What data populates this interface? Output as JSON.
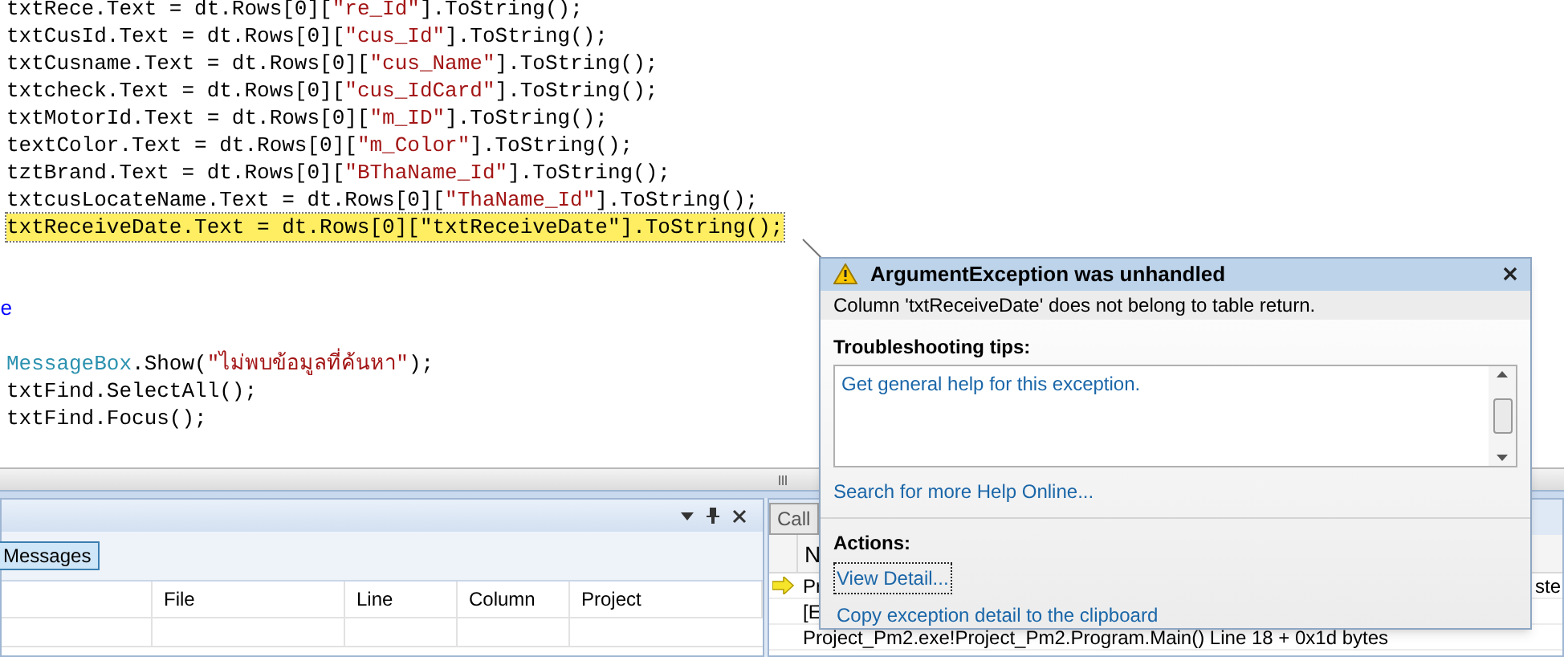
{
  "editor": {
    "lines": [
      {
        "kind": "code",
        "highlighted": false,
        "tokens": [
          {
            "kind": "plain",
            "text": "txtRece.Text = dt.Rows[0]["
          },
          {
            "kind": "string",
            "text": "\"re_Id\""
          },
          {
            "kind": "plain",
            "text": "].ToString();"
          }
        ]
      },
      {
        "kind": "code",
        "highlighted": false,
        "tokens": [
          {
            "kind": "plain",
            "text": "txtCusId.Text = dt.Rows[0]["
          },
          {
            "kind": "string",
            "text": "\"cus_Id\""
          },
          {
            "kind": "plain",
            "text": "].ToString();"
          }
        ]
      },
      {
        "kind": "code",
        "highlighted": false,
        "tokens": [
          {
            "kind": "plain",
            "text": "txtCusname.Text = dt.Rows[0]["
          },
          {
            "kind": "string",
            "text": "\"cus_Name\""
          },
          {
            "kind": "plain",
            "text": "].ToString();"
          }
        ]
      },
      {
        "kind": "code",
        "highlighted": false,
        "tokens": [
          {
            "kind": "plain",
            "text": "txtcheck.Text = dt.Rows[0]["
          },
          {
            "kind": "string",
            "text": "\"cus_IdCard\""
          },
          {
            "kind": "plain",
            "text": "].ToString();"
          }
        ]
      },
      {
        "kind": "code",
        "highlighted": false,
        "tokens": [
          {
            "kind": "plain",
            "text": "txtMotorId.Text = dt.Rows[0]["
          },
          {
            "kind": "string",
            "text": "\"m_ID\""
          },
          {
            "kind": "plain",
            "text": "].ToString();"
          }
        ]
      },
      {
        "kind": "code",
        "highlighted": false,
        "tokens": [
          {
            "kind": "plain",
            "text": "textColor.Text = dt.Rows[0]["
          },
          {
            "kind": "string",
            "text": "\"m_Color\""
          },
          {
            "kind": "plain",
            "text": "].ToString();"
          }
        ]
      },
      {
        "kind": "code",
        "highlighted": false,
        "tokens": [
          {
            "kind": "plain",
            "text": "tztBrand.Text = dt.Rows[0]["
          },
          {
            "kind": "string",
            "text": "\"BThaName_Id\""
          },
          {
            "kind": "plain",
            "text": "].ToString();"
          }
        ]
      },
      {
        "kind": "code",
        "highlighted": false,
        "tokens": [
          {
            "kind": "plain",
            "text": "txtcusLocateName.Text = dt.Rows[0]["
          },
          {
            "kind": "string",
            "text": "\"ThaName_Id\""
          },
          {
            "kind": "plain",
            "text": "].ToString();"
          }
        ]
      },
      {
        "kind": "code",
        "highlighted": true,
        "tokens": [
          {
            "kind": "plain",
            "text": "txtReceiveDate.Text = dt.Rows[0][\"txtReceiveDate\"].ToString();"
          }
        ]
      },
      {
        "kind": "blank"
      },
      {
        "kind": "blank"
      },
      {
        "kind": "outdent",
        "highlighted": false,
        "tokens": [
          {
            "kind": "keyword",
            "text": "e"
          }
        ]
      },
      {
        "kind": "blank"
      },
      {
        "kind": "code",
        "highlighted": false,
        "tokens": [
          {
            "kind": "type",
            "text": "MessageBox"
          },
          {
            "kind": "plain",
            "text": ".Show("
          },
          {
            "kind": "string",
            "text": "\"ไม่พบข้อมูลที่ค้นหา\""
          },
          {
            "kind": "plain",
            "text": ");"
          }
        ]
      },
      {
        "kind": "code",
        "highlighted": false,
        "tokens": [
          {
            "kind": "plain",
            "text": "txtFind.SelectAll();"
          }
        ]
      },
      {
        "kind": "code",
        "highlighted": false,
        "tokens": [
          {
            "kind": "plain",
            "text": "txtFind.Focus();"
          }
        ]
      }
    ]
  },
  "error_list": {
    "toolbar": [
      {
        "label": "Messages",
        "selected": true
      }
    ],
    "columns": [
      "File",
      "Line",
      "Column",
      "Project"
    ]
  },
  "call_stack": {
    "title": "Call",
    "column_header": "N",
    "rows": [
      {
        "current": true,
        "column_1": "Pr",
        "column_2": "ste"
      },
      {
        "current": false,
        "column_1": "[E"
      },
      {
        "current": false,
        "column_1": "Project_Pm2.exe!Project_Pm2.Program.Main() Line 18 + 0x1d bytes"
      }
    ]
  },
  "exception_popup": {
    "title": "ArgumentException was unhandled",
    "message": "Column 'txtReceiveDate' does not belong to table return.",
    "tips_heading": "Troubleshooting tips:",
    "tips": [
      "Get general help for this exception."
    ],
    "help_link": "Search for more Help Online...",
    "actions_heading": "Actions:",
    "actions": [
      {
        "label": "View Detail...",
        "focused": true
      },
      {
        "label": "Copy exception detail to the clipboard",
        "focused": false
      }
    ]
  }
}
